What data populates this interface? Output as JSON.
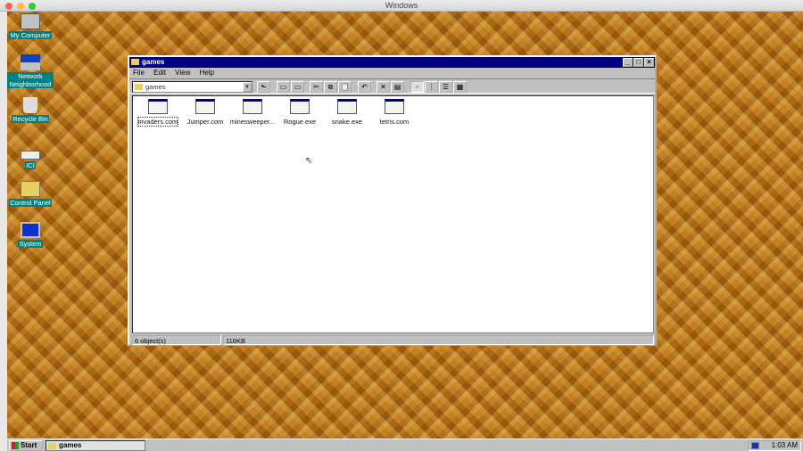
{
  "mac_window": {
    "title": "Windows"
  },
  "desktop_icons": [
    {
      "label": "My Computer",
      "icon": "computer-icon"
    },
    {
      "label": "Network Neighborhood",
      "icon": "network-icon"
    },
    {
      "label": "Recycle Bin",
      "icon": "recycle-bin-icon"
    },
    {
      "label": "ICI",
      "icon": "shortcut-icon"
    },
    {
      "label": "Control Panel",
      "icon": "control-panel-icon"
    },
    {
      "label": "System",
      "icon": "system-icon"
    }
  ],
  "window": {
    "title": "games",
    "menu": [
      "File",
      "Edit",
      "View",
      "Help"
    ],
    "address": "games",
    "files": [
      "invaders.com",
      "Jumper.com",
      "minesweeper...",
      "Rogue.exe",
      "snake.exe",
      "tetris.com"
    ],
    "status": {
      "objects": "6 object(s)",
      "size": "116KB"
    }
  },
  "taskbar": {
    "start": "Start",
    "task": "games",
    "clock": "1:03 AM"
  }
}
